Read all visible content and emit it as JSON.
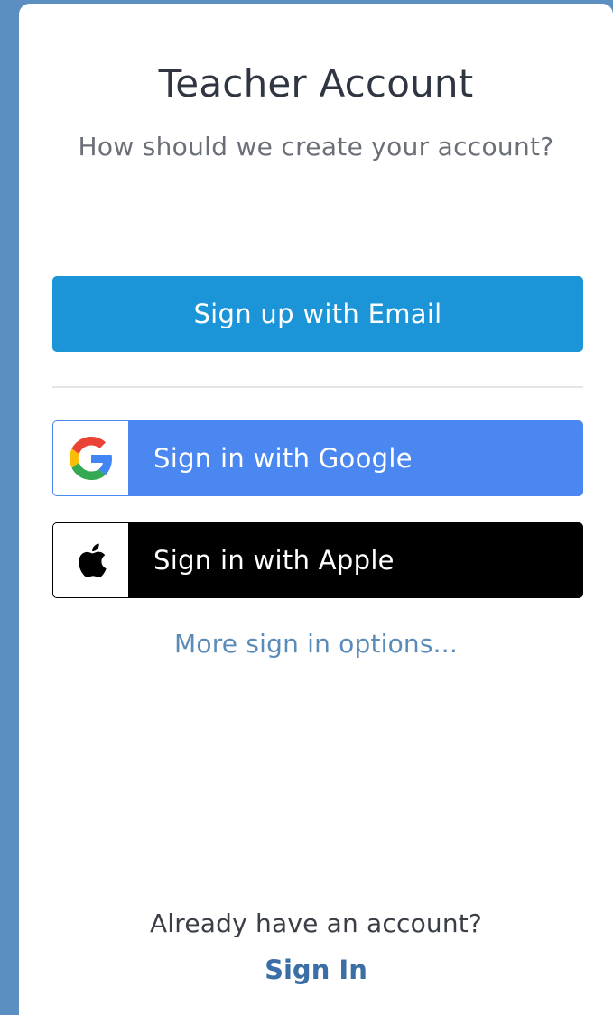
{
  "page": {
    "title": "Teacher Account",
    "subtitle": "How should we create your account?"
  },
  "actions": {
    "email_label": "Sign up with Email",
    "google_label": "Sign in with Google",
    "apple_label": "Sign in with Apple",
    "more_options_label": "More sign in options..."
  },
  "footer": {
    "prompt": "Already have an account?",
    "signin_label": "Sign In"
  },
  "icons": {
    "google": "google-logo-icon",
    "apple": "apple-logo-icon"
  },
  "colors": {
    "background": "#5b8fc2",
    "email_button": "#1c95d8",
    "google_button": "#4a87f0",
    "apple_button": "#000000",
    "link": "#5b8bb8",
    "signin": "#3a6ea5"
  }
}
